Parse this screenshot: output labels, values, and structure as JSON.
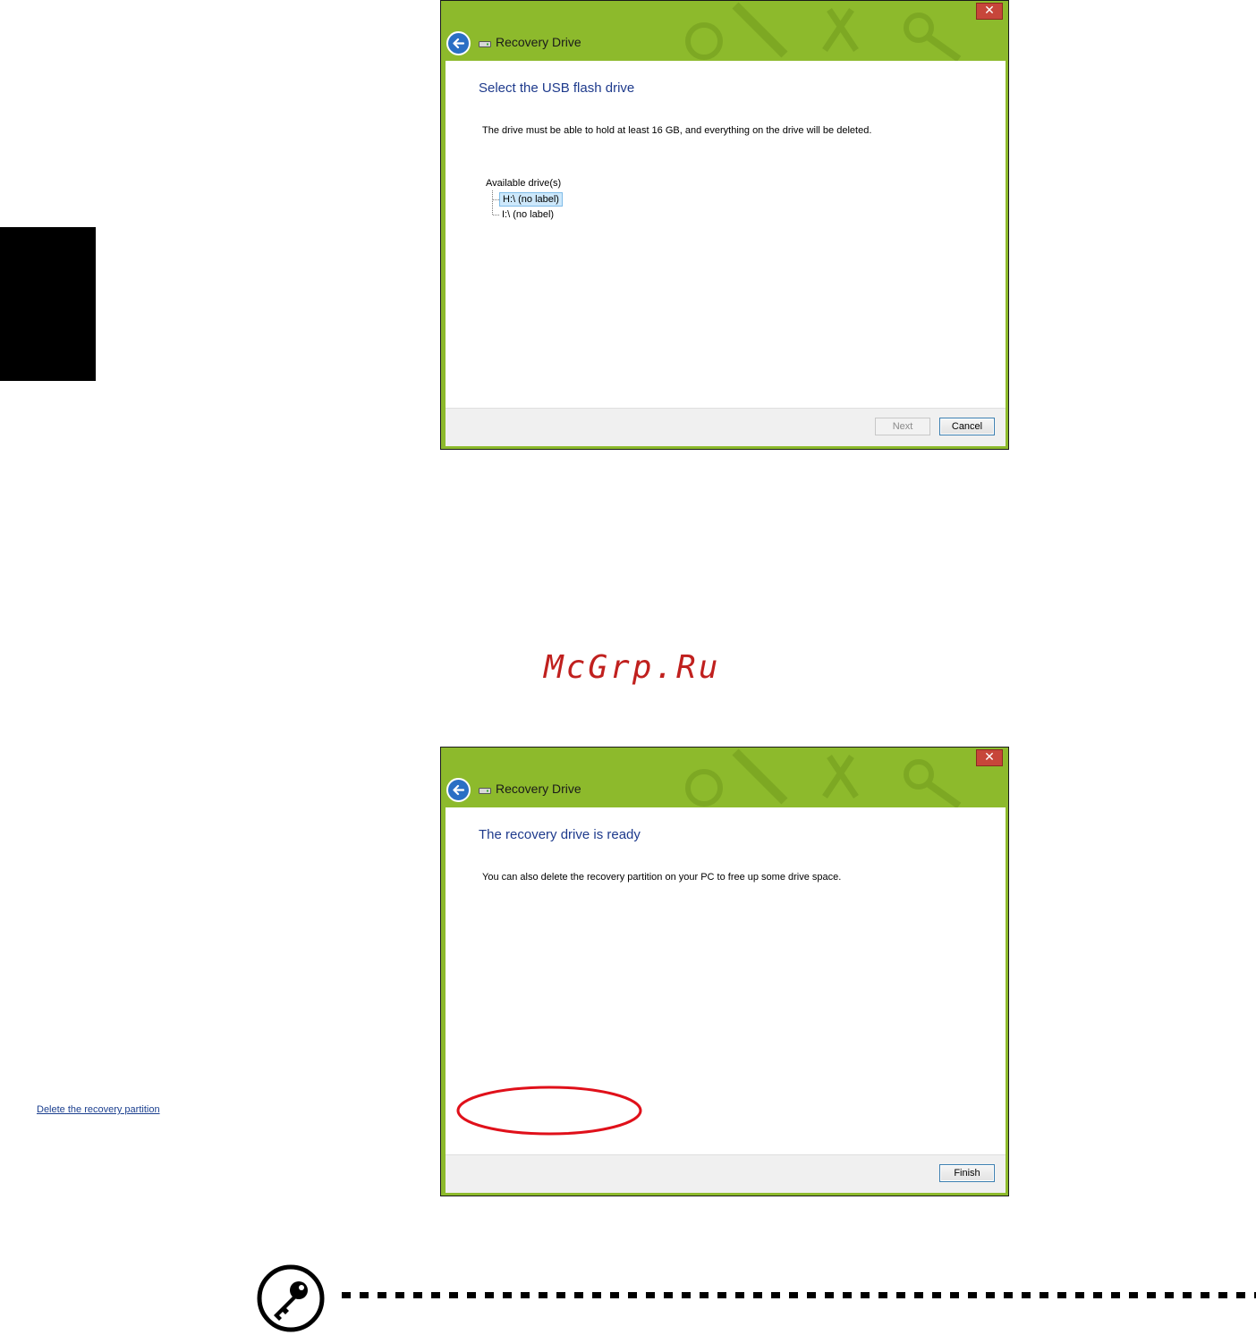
{
  "colors": {
    "window_frame": "#8dba2c",
    "heading_text": "#1e3a8c",
    "close_button": "#c7463a",
    "back_button": "#2a6fc4",
    "selection_bg": "#cde8fb",
    "annotation_ellipse": "#e0101a",
    "watermark_text": "#c0201e"
  },
  "dialog_select": {
    "title": "Recovery Drive",
    "close_glyph": "✕",
    "heading": "Select the USB flash drive",
    "description": "The drive must be able to hold at least 16 GB, and everything on the drive will be deleted.",
    "drives_label": "Available drive(s)",
    "drives": [
      {
        "label": "H:\\ (no label)",
        "selected": true
      },
      {
        "label": "I:\\ (no label)",
        "selected": false
      }
    ],
    "next_label": "Next",
    "cancel_label": "Cancel"
  },
  "watermark": "McGrp.Ru",
  "dialog_ready": {
    "title": "Recovery Drive",
    "close_glyph": "✕",
    "heading": "The recovery drive is ready",
    "description": "You can also delete the recovery partition on your PC to free up some drive space.",
    "delete_link": "Delete the recovery partition",
    "finish_label": "Finish"
  },
  "icons": {
    "back": "back-arrow-icon",
    "drive": "drive-icon",
    "close": "close-icon",
    "note": "key-note-icon"
  }
}
